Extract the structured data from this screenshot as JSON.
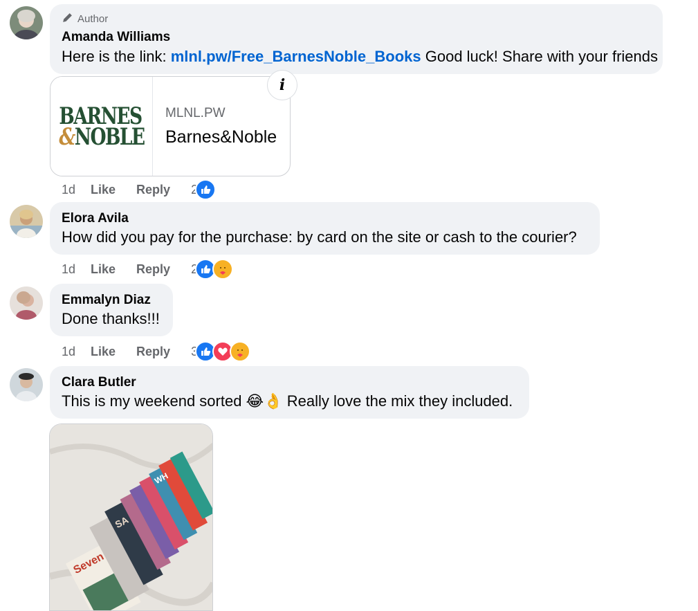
{
  "comments": [
    {
      "author_badge": "Author",
      "name": "Amanda Williams",
      "text_prefix": "Here is the link: ",
      "link_text": "mlnl.pw/Free_BarnesNoble_Books",
      "text_suffix": " Good luck! Share with your friends",
      "time": "1d",
      "like_label": "Like",
      "reply_label": "Reply",
      "reaction_count": "2",
      "reactions": [
        "like"
      ],
      "avatar_color": "#8a7b6f"
    },
    {
      "name": "Elora Avila",
      "text": "How did you pay for the purchase: by card on the site or cash to the courier?",
      "time": "1d",
      "like_label": "Like",
      "reply_label": "Reply",
      "reaction_count": "2",
      "reactions": [
        "like",
        "care"
      ],
      "avatar_color": "#c9a47a"
    },
    {
      "name": "Emmalyn Diaz",
      "text": "Done thanks!!!",
      "time": "1d",
      "like_label": "Like",
      "reply_label": "Reply",
      "reaction_count": "3",
      "reactions": [
        "like",
        "love",
        "care"
      ],
      "avatar_color": "#b89a8c"
    },
    {
      "name": "Clara Butler",
      "text_prefix": "This is my weekend sorted ",
      "emoji": "😂👌",
      "text_suffix": " Really love the mix they included.",
      "avatar_color": "#7a8a96"
    }
  ],
  "link_preview": {
    "logo_line1": "BARNES",
    "logo_amp": "&",
    "logo_line2": "NOBLE",
    "domain": "MLNL.PW",
    "title": "Barnes&Noble",
    "info_icon": "i"
  },
  "photo": {
    "book_text_1": "Seven",
    "book_text_2": "SA",
    "book_text_3": "WH"
  }
}
